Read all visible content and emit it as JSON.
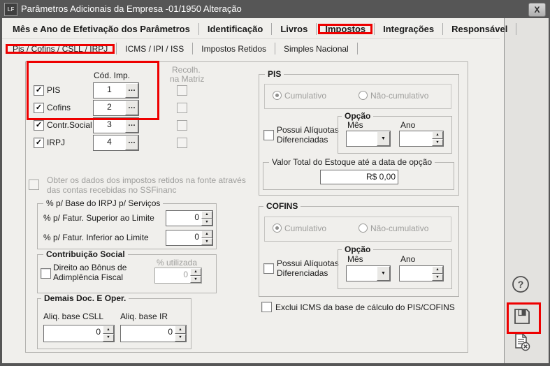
{
  "window": {
    "title": "Parâmetros Adicionais da Empresa -01/1950 Alteração",
    "icon_text": "LF"
  },
  "colors": {
    "titlebar": "#565656",
    "dialog_bg": "#f0efec",
    "sidebar_bg": "#e3e2df",
    "annotation_red": "#ee0000",
    "disabled_text": "#9e9e9c"
  },
  "icons": {
    "checkmark": "✓",
    "combo_arrow": "▼",
    "spin_up": "▲",
    "spin_down": "▼",
    "ellipsis": "…",
    "help_glyph": "?",
    "close_glyph": "X"
  },
  "tabs_primary": {
    "items": [
      {
        "label": "Mês e Ano de Efetivação dos Parâmetros",
        "active": false
      },
      {
        "label": "Identificação",
        "active": false
      },
      {
        "label": "Livros",
        "active": false
      },
      {
        "label": "Impostos",
        "active": true,
        "annotated": true
      },
      {
        "label": "Integrações",
        "active": false
      },
      {
        "label": "Responsável",
        "active": false
      }
    ]
  },
  "tabs_secondary": {
    "items": [
      {
        "label": "Pis / Cofins / CSLL / IRPJ",
        "active": true,
        "annotated": true
      },
      {
        "label": "ICMS / IPI / ISS",
        "active": false
      },
      {
        "label": "Impostos Retidos",
        "active": false
      },
      {
        "label": "Simples Nacional",
        "active": false
      }
    ]
  },
  "tax_table": {
    "code_header": "Cód. Imp.",
    "recolh_header_line1": "Recolh.",
    "recolh_header_line2": "na Matriz",
    "rows": [
      {
        "label": "PIS",
        "checked": true,
        "code": "1",
        "recolh_checked": false
      },
      {
        "label": "Cofins",
        "checked": true,
        "code": "2",
        "recolh_checked": false
      },
      {
        "label": "Contr.Social",
        "checked": true,
        "code": "3",
        "recolh_checked": false
      },
      {
        "label": "IRPJ",
        "checked": true,
        "code": "4",
        "recolh_checked": false
      }
    ]
  },
  "obter_checkbox": {
    "checked": false,
    "disabled": true,
    "line1": "Obter os dados dos impostos retidos na fonte através",
    "line2": "das contas recebidas no SSFinanc"
  },
  "irpj_base_group": {
    "title": "% p/ Base do IRPJ p/ Serviços",
    "superior_label": "% p/ Fatur. Superior ao Limite",
    "superior_value": "0",
    "inferior_label": "% p/ Fatur. Inferior ao Limite",
    "inferior_value": "0"
  },
  "contribuicao_group": {
    "title": "Contribuição Social",
    "checkbox_line1": "Direito ao Bônus de",
    "checkbox_line2": "Adimplência Fiscal",
    "checkbox_checked": false,
    "percent_label": "% utilizada",
    "percent_value": "0"
  },
  "demais_group": {
    "title": "Demais Doc. E Oper.",
    "csll_label": "Aliq. base CSLL",
    "csll_value": "0",
    "ir_label": "Aliq. base IR",
    "ir_value": "0"
  },
  "pis_group": {
    "title": "PIS",
    "radio_cumulativo": "Cumulativo",
    "radio_nao_cumulativo": "Não-cumulativo",
    "radio_selected": "Cumulativo",
    "aliquotas_line1": "Possui Alíquotas",
    "aliquotas_line2": "Diferenciadas",
    "aliquotas_checked": false,
    "opcao": {
      "title": "Opção",
      "mes_label": "Mês",
      "mes_value": "",
      "ano_label": "Ano",
      "ano_value": ""
    },
    "valor_group": {
      "title": "Valor Total do Estoque até a data de opção",
      "value": "R$ 0,00"
    }
  },
  "cofins_group": {
    "title": "COFINS",
    "radio_cumulativo": "Cumulativo",
    "radio_nao_cumulativo": "Não-cumulativo",
    "radio_selected": "Cumulativo",
    "aliquotas_line1": "Possui Alíquotas",
    "aliquotas_line2": "Diferenciadas",
    "aliquotas_checked": false,
    "opcao": {
      "title": "Opção",
      "mes_label": "Mês",
      "mes_value": "",
      "ano_label": "Ano",
      "ano_value": ""
    }
  },
  "exclui_checkbox": {
    "checked": false,
    "label": "Exclui ICMS da base de cálculo do PIS/COFINS"
  },
  "sidebar": {
    "buttons": [
      {
        "name": "help"
      },
      {
        "name": "save",
        "annotated": true
      },
      {
        "name": "cancel"
      }
    ]
  }
}
